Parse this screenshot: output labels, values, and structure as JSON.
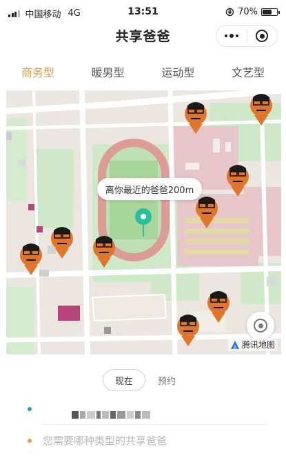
{
  "status_bar": {
    "carrier": "中国移动",
    "network": "4G",
    "time": "13:51",
    "battery": "70%",
    "battery_level": 0.7
  },
  "nav": {
    "title": "共享爸爸"
  },
  "tabs": [
    {
      "label": "商务型",
      "active": true
    },
    {
      "label": "暖男型",
      "active": false
    },
    {
      "label": "运动型",
      "active": false
    },
    {
      "label": "文艺型",
      "active": false
    }
  ],
  "map": {
    "bubble": "离你最近的爸爸200m",
    "provider": "腾讯地图"
  },
  "time_toggle": {
    "now": "现在",
    "later": "预约"
  },
  "destination": {
    "placeholder": "您需要哪种类型的共享爸爸"
  },
  "colors": {
    "accent": "#e59a3d",
    "pin": "#2bbf9f",
    "origin_dot": "#1ea5a8",
    "destination_dot": "#e59a3d"
  }
}
